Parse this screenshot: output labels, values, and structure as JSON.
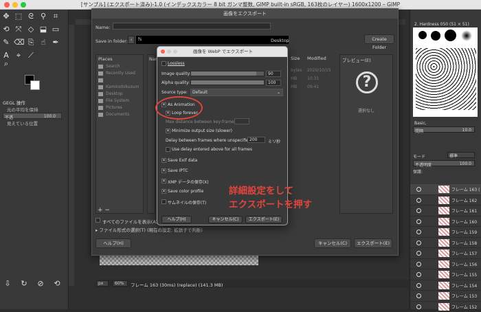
{
  "window": {
    "title": "[サンプル] (エクスポート済み)-1.0 (インデックスカラー 8 bit ガンマ整数, GIMP built-in sRGB, 163枚のレイヤー) 1600x1200 – GIMP",
    "colors": {
      "close": "#ff5f57",
      "min": "#febc2e",
      "max": "#28c840"
    }
  },
  "toolbox": {
    "options_title": "GEGL 操作",
    "opt1": "元の平均を保持",
    "opt2_label": "不透",
    "opt2_value": "100.0",
    "opt3": "見えている位置"
  },
  "export_dialog": {
    "title": "画像をエクスポート",
    "name_label": "Name:",
    "save_in_label": "Save in folder:",
    "path_seg": "fs",
    "path_end": "Desktop",
    "create_folder": "Create Folder",
    "places_header": "Places",
    "name_col": "Nam",
    "size_col": "Size",
    "modified_col": "Modified",
    "places": [
      "Search",
      "Recently Used",
      "",
      "Kaminotokusum",
      "Desktop",
      "File System",
      "Pictures",
      "Documents"
    ],
    "file_sizes": [
      "bytes",
      "MB",
      "MB"
    ],
    "file_dates": [
      "2020/10/15",
      "10:31",
      "09:41"
    ],
    "preview_header": "プレビュー(E)",
    "preview_none": "選択なし",
    "show_all_files": "すべてのファイルを表示(A)",
    "select_type": "ファイル形式の選択(T) (現在の設定: 拡張子で判断)",
    "help_button": "ヘルプ(H)",
    "cancel_button": "キャンセル(C)",
    "export_button": "エクスポート(E)"
  },
  "webp_dialog": {
    "title": "画像を WebP でエクスポート",
    "lossless": "Lossless",
    "image_quality_label": "Image quality:",
    "image_quality": 90,
    "alpha_quality_label": "Alpha quality:",
    "alpha_quality": 100,
    "source_type_label": "Source type:",
    "source_type_value": "Default",
    "as_animation": "As Animation",
    "loop_forever": "Loop forever",
    "max_distance": "Max distance between key-frames:",
    "minimize": "Minimize output size (slower)",
    "delay_label": "Delay between frames where unspecified:",
    "delay_value": "200",
    "delay_unit": "ミリ秒",
    "use_delay": "Use delay entered above for all frames",
    "save_exif": "Save Exif data",
    "save_iptc": "Save IPTC",
    "save_xmp": "XMP データの保存(X)",
    "save_color": "Save color profile",
    "save_thumb": "サムネイルの保存(T)",
    "help_button": "ヘルプ(H)",
    "cancel_button": "キャンセル(C)",
    "export_button": "エクスポート(E)"
  },
  "annotation": {
    "line1": "詳細設定をして",
    "line2": "エクスポートを押す",
    "color": "#e0453c"
  },
  "right_panel": {
    "brush_name": "2. Hardness 050 (51 × 51)",
    "basic": "Basic,",
    "spacing_label": "間隔",
    "spacing_value": "10.0",
    "mode_label": "モード",
    "mode_value": "標準",
    "opacity_label": "不透明度",
    "opacity_value": "100.0",
    "lock_label": "保護:",
    "layers": [
      "フレーム 163 (",
      "フレーム 162",
      "フレーム 161",
      "フレーム 160",
      "フレーム 159",
      "フレーム 158",
      "フレーム 157",
      "フレーム 156",
      "フレーム 155",
      "フレーム 154",
      "フレーム 153",
      "フレーム 152"
    ]
  },
  "statusbar": {
    "unit": "px",
    "zoom": "60%",
    "text": "フレーム 163 (30ms) (replace) (141.3 MB)"
  }
}
